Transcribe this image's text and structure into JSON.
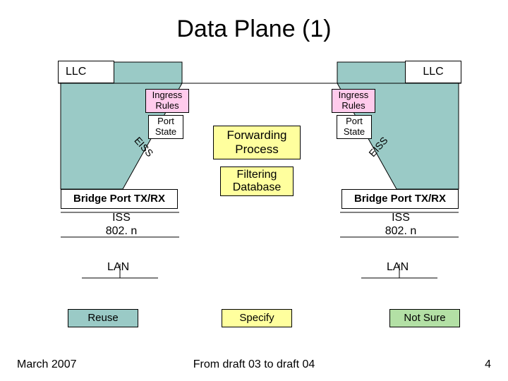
{
  "title": "Data Plane (1)",
  "llc": "LLC",
  "ingress_rules": "Ingress Rules",
  "port_state": "Port State",
  "forwarding_process": "Forwarding Process",
  "filtering_database": "Filtering Database",
  "bridge_port": "Bridge Port TX/RX",
  "eiss": "EISS",
  "iss": "ISS 802. n",
  "lan": "LAN",
  "legend": {
    "reuse": "Reuse",
    "specify": "Specify",
    "not_sure": "Not Sure"
  },
  "footer_date": "March 2007",
  "footer_text": "From draft 03 to draft 04",
  "page_number": "4",
  "colors": {
    "pink": "#ffcbec",
    "yellow": "#ffff9e",
    "teal": "#9acac6",
    "green": "#b3e0a5"
  }
}
